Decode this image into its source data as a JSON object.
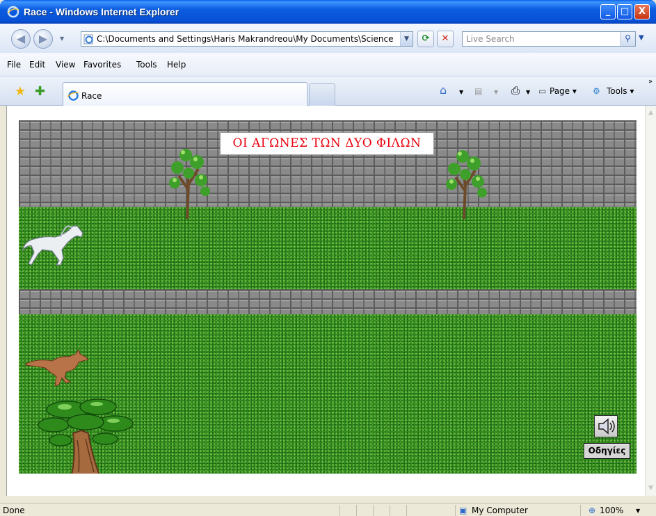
{
  "window": {
    "title": "Race - Windows Internet Explorer",
    "controls": [
      "_",
      "□",
      "X"
    ]
  },
  "address_bar": {
    "url": "C:\\Documents and Settings\\Haris Makrandreou\\My Documents\\Science Lab\\",
    "search_placeholder": "Live Search"
  },
  "menu": {
    "items": [
      "File",
      "Edit",
      "View",
      "Favorites",
      "Tools",
      "Help"
    ]
  },
  "tab": {
    "label": "Race"
  },
  "command_bar": {
    "page_label": "Page",
    "tools_label": "Tools"
  },
  "game": {
    "title_banner": "ΟΙ ΑΓΩΝΕΣ ΤΩΝ ΔΥΟ ΦΙΛΩΝ",
    "instructions_button": "Οδηγίες"
  },
  "status_bar": {
    "status_text": "Done",
    "zone": "My Computer",
    "zoom": "100%"
  },
  "colors": {
    "titlebar": "#0b5ce0",
    "banner_text": "#e8000d",
    "grass": "#2f8a1f",
    "wall": "#8a8a8a"
  }
}
